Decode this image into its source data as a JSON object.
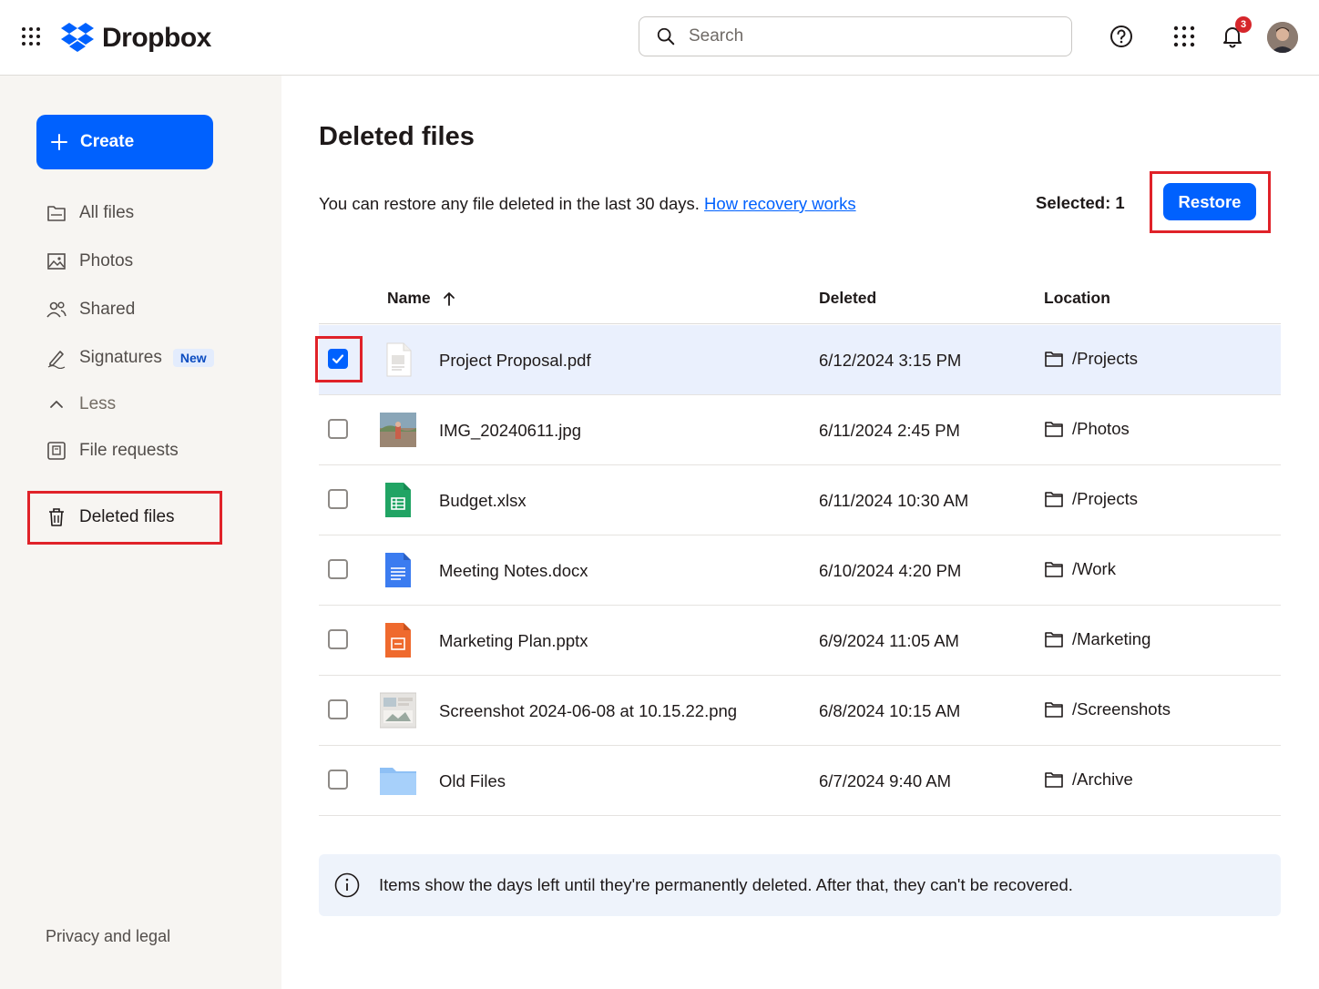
{
  "header": {
    "logo_text": "Dropbox",
    "search_placeholder": "Search",
    "notification_count": "3"
  },
  "sidebar": {
    "create_label": "Create",
    "items": [
      {
        "label": "All files",
        "icon": "folder-icon"
      },
      {
        "label": "Photos",
        "icon": "image-icon"
      },
      {
        "label": "Shared",
        "icon": "people-icon"
      },
      {
        "label": "Signatures",
        "icon": "signature-icon",
        "badge": "New"
      },
      {
        "label": "Less",
        "icon": "chevron-up-icon"
      },
      {
        "label": "File requests",
        "icon": "file-request-icon"
      },
      {
        "label": "Deleted files",
        "icon": "trash-icon"
      }
    ],
    "footer": "Privacy and legal"
  },
  "main": {
    "title": "Deleted files",
    "description": "You can restore any file deleted in the last 30 days.",
    "link": "How recovery works",
    "selected": "Selected: 1",
    "restore_label": "Restore",
    "columns": {
      "name": "Name",
      "deleted": "Deleted",
      "location": "Location"
    },
    "rows": [
      {
        "name": "Project Proposal.pdf",
        "deleted": "6/12/2024 3:15 PM",
        "location": "/Projects",
        "type": "pdf",
        "checked": true
      },
      {
        "name": "IMG_20240611.jpg",
        "deleted": "6/11/2024 2:45 PM",
        "location": "/Photos",
        "type": "image",
        "checked": false
      },
      {
        "name": "Budget.xlsx",
        "deleted": "6/11/2024 10:30 AM",
        "location": "/Projects",
        "type": "sheet",
        "checked": false
      },
      {
        "name": "Meeting Notes.docx",
        "deleted": "6/10/2024 4:20 PM",
        "location": "/Work",
        "type": "doc",
        "checked": false
      },
      {
        "name": "Marketing Plan.pptx",
        "deleted": "6/9/2024 11:05 AM",
        "location": "/Marketing",
        "type": "slides",
        "checked": false
      },
      {
        "name": "Screenshot 2024-06-08 at 10.15.22.png",
        "deleted": "6/8/2024 10:15 AM",
        "location": "/Screenshots",
        "type": "screenshot",
        "checked": false
      },
      {
        "name": "Old Files",
        "deleted": "6/7/2024 9:40 AM",
        "location": "/Archive",
        "type": "folder",
        "checked": false
      }
    ],
    "info_text": "Items show the days left until they're permanently deleted. After that, they can't be recovered."
  },
  "colors": {
    "accent": "#0061fe",
    "highlight_box": "#e02229",
    "selected_row": "#eaf0fd",
    "sidebar_bg": "#f7f5f2"
  }
}
